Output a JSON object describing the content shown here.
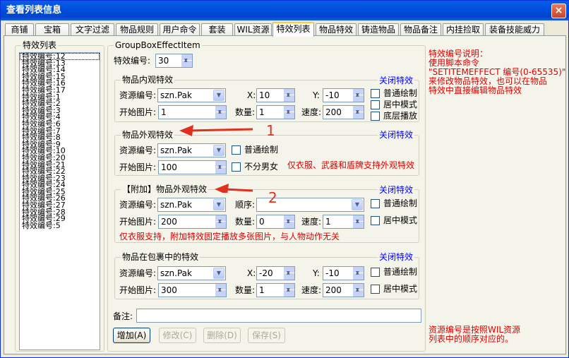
{
  "window": {
    "title": "查看列表信息",
    "close_glyph": "×"
  },
  "tabs": [
    {
      "label": "商铺"
    },
    {
      "label": "宝箱"
    },
    {
      "label": "文字过滤"
    },
    {
      "label": "物品规则"
    },
    {
      "label": "用户命令"
    },
    {
      "label": "套装"
    },
    {
      "label": "WIL资源"
    },
    {
      "label": "特效列表"
    },
    {
      "label": "物品特效"
    },
    {
      "label": "铸造物品"
    },
    {
      "label": "物品备注"
    },
    {
      "label": "内挂捡取"
    },
    {
      "label": "装备技能威力"
    }
  ],
  "active_tab": "特效列表",
  "left_panel": {
    "title": "特效列表",
    "items": [
      "特效编号:12",
      "特效编号:13",
      "特效编号:14",
      "特效编号:15",
      "特效编号:16",
      "特效编号:17",
      "特效编号:1",
      "特效编号:2",
      "特效编号:3",
      "特效编号:4",
      "特效编号:6",
      "特效编号:7",
      "特效编号:8",
      "特效编号:9",
      "特效编号:10",
      "特效编号:20",
      "特效编号:21",
      "特效编号:22",
      "特效编号:23",
      "特效编号:24",
      "特效编号:25",
      "特效编号:26",
      "特效编号:27",
      "特效编号:28",
      "特效编号:29",
      "特效编号:5"
    ]
  },
  "editor": {
    "group_title": "GroupBoxEffectItem",
    "effect_id_label": "特效编号:",
    "effect_id_value": "30",
    "inner": {
      "title": "物品内观特效",
      "close_link": "关闭特效",
      "res_label": "资源编号:",
      "res_value": "szn.Pak",
      "x_label": "X:",
      "x_value": "10",
      "y_label": "Y:",
      "y_value": "-10",
      "start_label": "开始图片:",
      "start_value": "1",
      "count_label": "数量:",
      "count_value": "1",
      "speed_label": "速度:",
      "speed_value": "200",
      "chk_normal": "普通绘制",
      "chk_center": "居中模式",
      "chk_bottom": "底层播放"
    },
    "outer": {
      "title": "物品外观特效",
      "close_link": "关闭特效",
      "res_label": "资源编号:",
      "res_value": "szn.Pak",
      "start_label": "开始图片:",
      "start_value": "100",
      "chk_normal": "普通绘制",
      "chk_gender": "不分男女",
      "note": "仅衣服、武器和盾牌支持外观特效"
    },
    "extra": {
      "title": "【附加】物品外观特效",
      "close_link": "关闭特效",
      "res_label": "资源编号:",
      "res_value": "szn.Pak",
      "order_label": "顺序:",
      "order_value": "",
      "start_label": "开始图片:",
      "start_value": "200",
      "count_label": "数量:",
      "count_value": "0",
      "speed_label": "速度:",
      "speed_value": "1",
      "chk_normal": "普通绘制",
      "chk_center": "居中模式",
      "note": "仅衣服支持，附加特效固定播放多张图片，与人物动作无关"
    },
    "bag": {
      "title": "物品在包裹中的特效",
      "close_link": "关闭特效",
      "res_label": "资源编号:",
      "res_value": "szn.Pak",
      "x_label": "X:",
      "x_value": "-20",
      "y_label": "Y:",
      "y_value": "-10",
      "start_label": "开始图片:",
      "start_value": "300",
      "count_label": "数量:",
      "count_value": "1",
      "speed_label": "速度:",
      "speed_value": "200",
      "chk_normal": "普通绘制",
      "chk_center": "居中模式"
    },
    "remark_label": "备注:",
    "remark_value": "",
    "buttons": {
      "add": "增加(A)",
      "modify": "修改(C)",
      "delete": "删除(D)",
      "save": "保存(S)"
    }
  },
  "help": {
    "top": [
      "特效编号说明：",
      "使用脚本命令",
      "\"SETITEMEFFECT  编号(0-65535)\"",
      "来修改物品特效，也可以在物品",
      "特效中直接编辑物品特效"
    ],
    "bottom": [
      "资源编号是按照WIL资源",
      "列表中的顺序对应的。"
    ]
  },
  "annotations": {
    "arrow1_label": "1",
    "arrow2_label": "2"
  },
  "colors": {
    "title_bar": "#0054e3",
    "help_text": "#e00000",
    "link": "#0000ff",
    "annotation": "#e03020"
  }
}
